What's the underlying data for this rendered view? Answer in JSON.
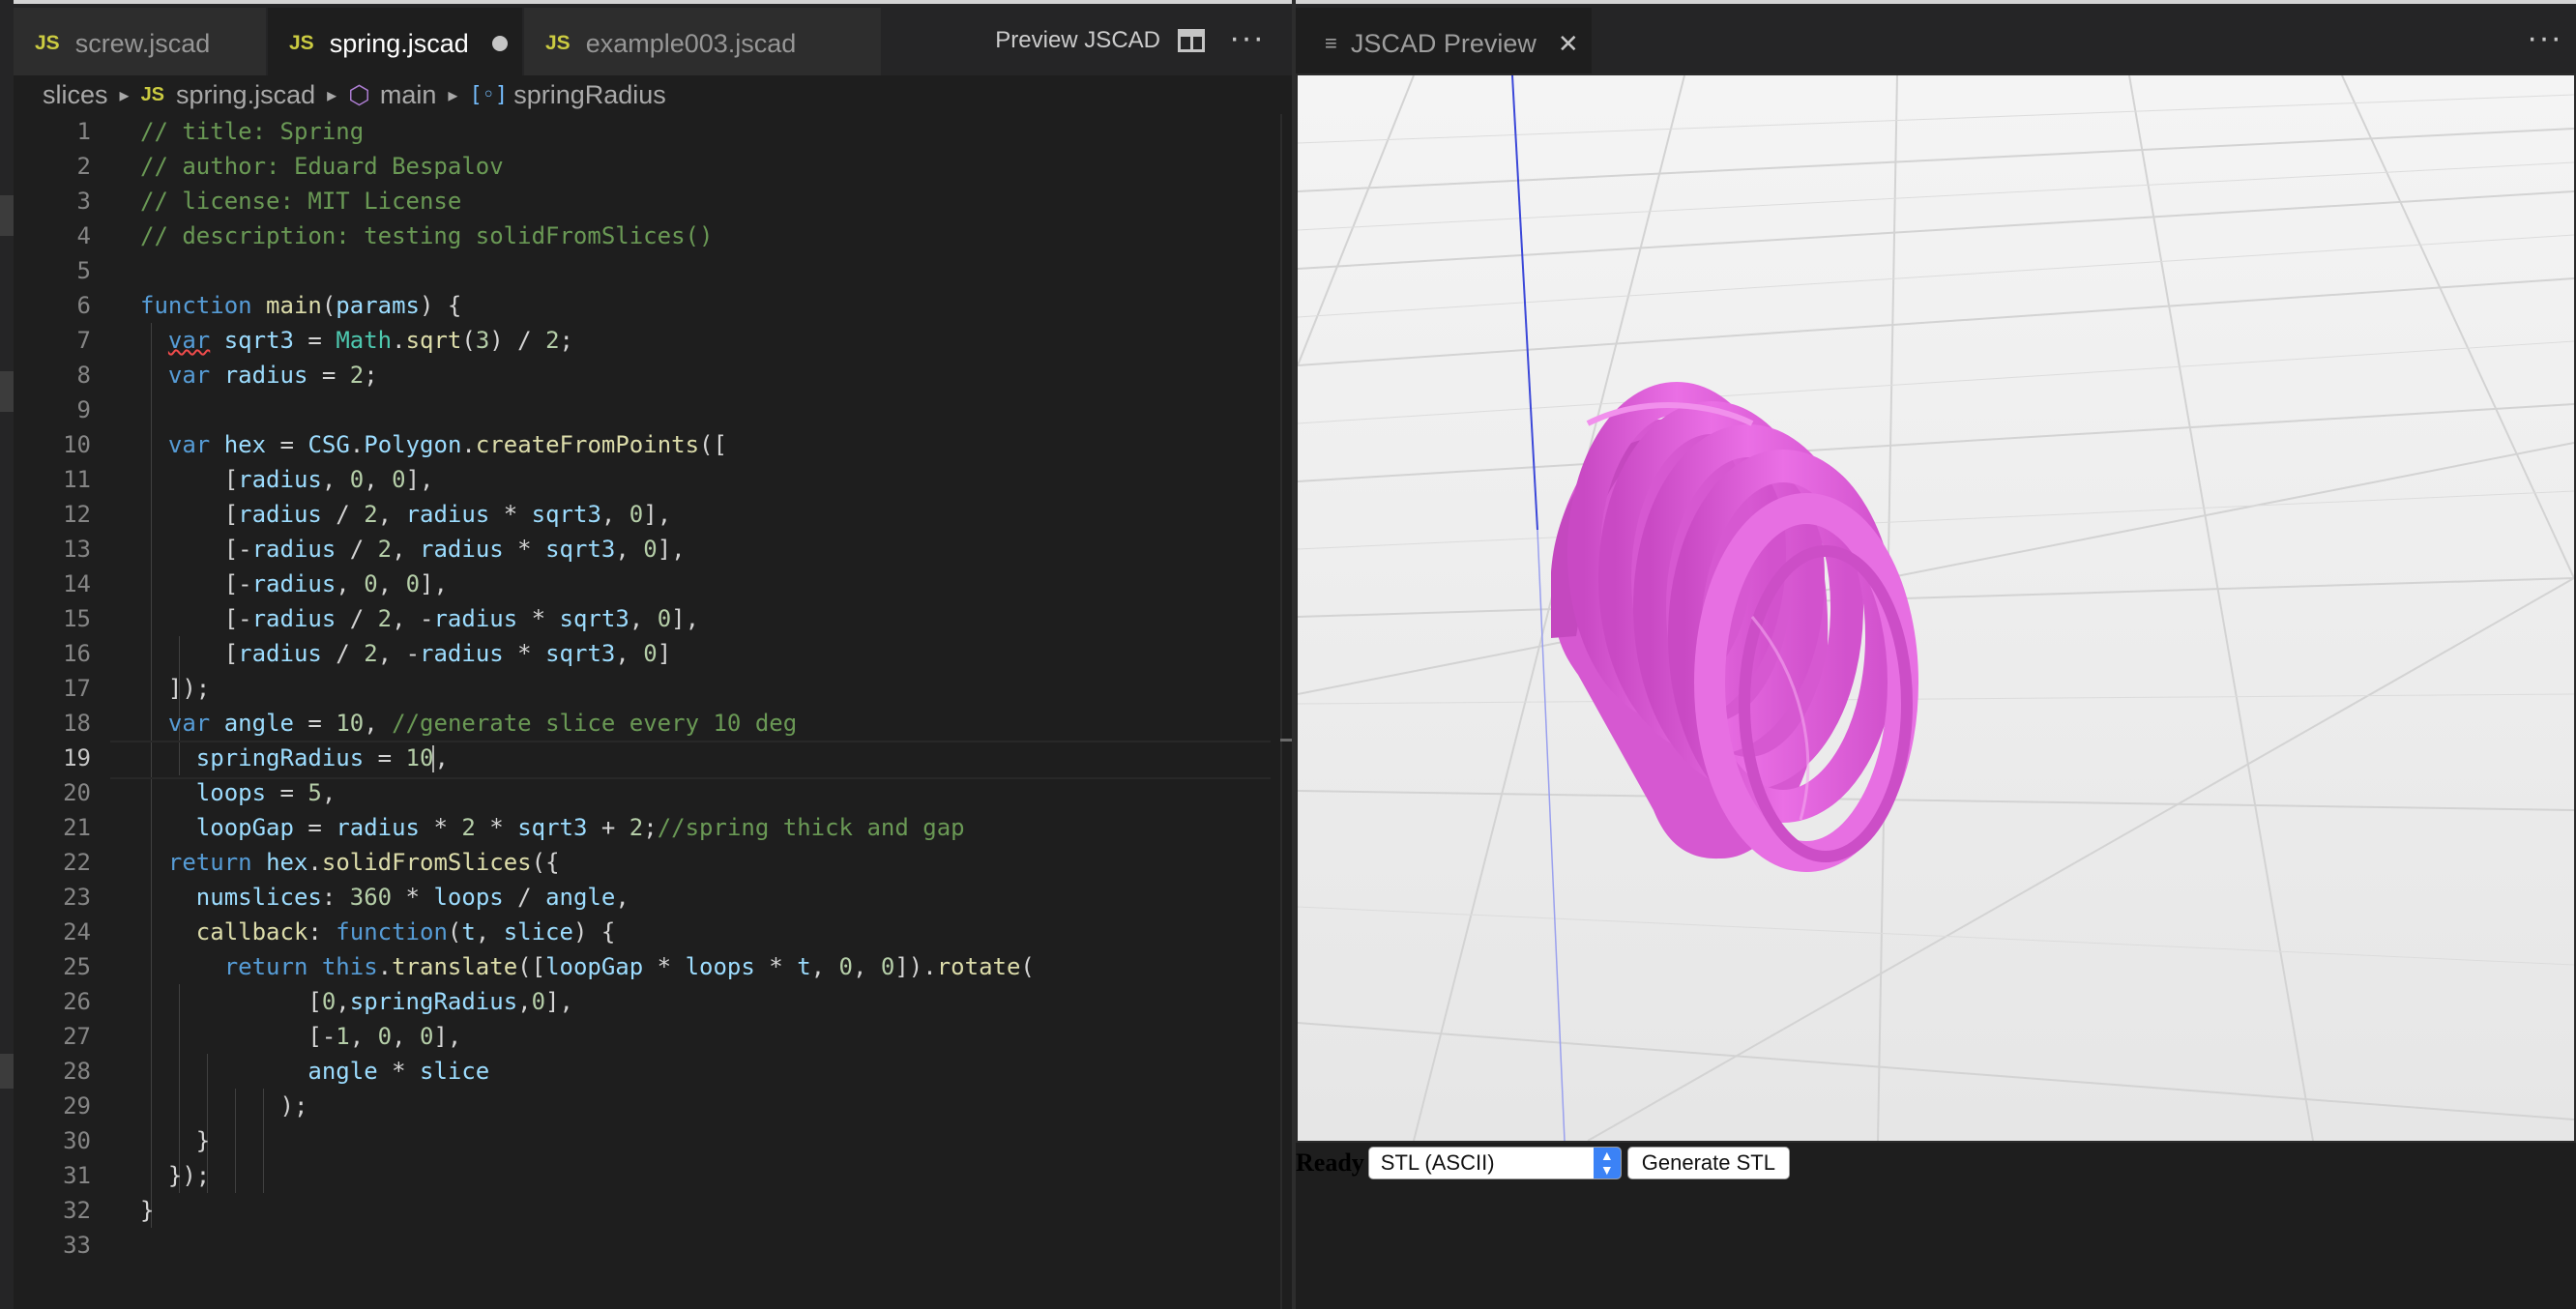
{
  "editor": {
    "tabs": [
      {
        "icon": "JS",
        "label": "screw.jscad"
      },
      {
        "icon": "JS",
        "label": "spring.jscad"
      },
      {
        "icon": "JS",
        "label": "example003.jscad"
      }
    ],
    "preview_action": "Preview JSCAD",
    "more": "···",
    "breadcrumb": {
      "folder": "slices",
      "file_icon": "JS",
      "file": "spring.jscad",
      "function": "main",
      "symbol": "springRadius"
    },
    "current_line": 19,
    "lines": [
      {
        "n": "1"
      },
      {
        "n": "2"
      },
      {
        "n": "3"
      },
      {
        "n": "4"
      },
      {
        "n": "5"
      },
      {
        "n": "6"
      },
      {
        "n": "7"
      },
      {
        "n": "8"
      },
      {
        "n": "9"
      },
      {
        "n": "10"
      },
      {
        "n": "11"
      },
      {
        "n": "12"
      },
      {
        "n": "13"
      },
      {
        "n": "14"
      },
      {
        "n": "15"
      },
      {
        "n": "16"
      },
      {
        "n": "17"
      },
      {
        "n": "18"
      },
      {
        "n": "19"
      },
      {
        "n": "20"
      },
      {
        "n": "21"
      },
      {
        "n": "22"
      },
      {
        "n": "23"
      },
      {
        "n": "24"
      },
      {
        "n": "25"
      },
      {
        "n": "26"
      },
      {
        "n": "27"
      },
      {
        "n": "28"
      },
      {
        "n": "29"
      },
      {
        "n": "30"
      },
      {
        "n": "31"
      },
      {
        "n": "32"
      },
      {
        "n": "33"
      }
    ],
    "code": [
      [
        [
          "c",
          "// title: Spring"
        ]
      ],
      [
        [
          "c",
          "// author: Eduard Bespalov"
        ]
      ],
      [
        [
          "c",
          "// license: MIT License"
        ]
      ],
      [
        [
          "c",
          "// description: testing solidFromSlices()"
        ]
      ],
      [],
      [
        [
          "k",
          "function"
        ],
        [
          "p",
          " "
        ],
        [
          "f",
          "main"
        ],
        [
          "p",
          "("
        ],
        [
          "v",
          "params"
        ],
        [
          "p",
          ") {"
        ]
      ],
      [
        [
          "p",
          "  "
        ],
        [
          "ks",
          "var"
        ],
        [
          "p",
          " "
        ],
        [
          "v",
          "sqrt3"
        ],
        [
          "p",
          " = "
        ],
        [
          "t",
          "Math"
        ],
        [
          "p",
          "."
        ],
        [
          "f",
          "sqrt"
        ],
        [
          "p",
          "("
        ],
        [
          "n",
          "3"
        ],
        [
          "p",
          ") / "
        ],
        [
          "n",
          "2"
        ],
        [
          "p",
          ";"
        ]
      ],
      [
        [
          "p",
          "  "
        ],
        [
          "k",
          "var"
        ],
        [
          "p",
          " "
        ],
        [
          "v",
          "radius"
        ],
        [
          "p",
          " = "
        ],
        [
          "n",
          "2"
        ],
        [
          "p",
          ";"
        ]
      ],
      [],
      [
        [
          "p",
          "  "
        ],
        [
          "k",
          "var"
        ],
        [
          "p",
          " "
        ],
        [
          "v",
          "hex"
        ],
        [
          "p",
          " = "
        ],
        [
          "v",
          "CSG"
        ],
        [
          "p",
          "."
        ],
        [
          "v",
          "Polygon"
        ],
        [
          "p",
          "."
        ],
        [
          "f",
          "createFromPoints"
        ],
        [
          "p",
          "(["
        ]
      ],
      [
        [
          "p",
          "      ["
        ],
        [
          "v",
          "radius"
        ],
        [
          "p",
          ", "
        ],
        [
          "n",
          "0"
        ],
        [
          "p",
          ", "
        ],
        [
          "n",
          "0"
        ],
        [
          "p",
          "],"
        ]
      ],
      [
        [
          "p",
          "      ["
        ],
        [
          "v",
          "radius"
        ],
        [
          "p",
          " / "
        ],
        [
          "n",
          "2"
        ],
        [
          "p",
          ", "
        ],
        [
          "v",
          "radius"
        ],
        [
          "p",
          " * "
        ],
        [
          "v",
          "sqrt3"
        ],
        [
          "p",
          ", "
        ],
        [
          "n",
          "0"
        ],
        [
          "p",
          "],"
        ]
      ],
      [
        [
          "p",
          "      [-"
        ],
        [
          "v",
          "radius"
        ],
        [
          "p",
          " / "
        ],
        [
          "n",
          "2"
        ],
        [
          "p",
          ", "
        ],
        [
          "v",
          "radius"
        ],
        [
          "p",
          " * "
        ],
        [
          "v",
          "sqrt3"
        ],
        [
          "p",
          ", "
        ],
        [
          "n",
          "0"
        ],
        [
          "p",
          "],"
        ]
      ],
      [
        [
          "p",
          "      [-"
        ],
        [
          "v",
          "radius"
        ],
        [
          "p",
          ", "
        ],
        [
          "n",
          "0"
        ],
        [
          "p",
          ", "
        ],
        [
          "n",
          "0"
        ],
        [
          "p",
          "],"
        ]
      ],
      [
        [
          "p",
          "      [-"
        ],
        [
          "v",
          "radius"
        ],
        [
          "p",
          " / "
        ],
        [
          "n",
          "2"
        ],
        [
          "p",
          ", -"
        ],
        [
          "v",
          "radius"
        ],
        [
          "p",
          " * "
        ],
        [
          "v",
          "sqrt3"
        ],
        [
          "p",
          ", "
        ],
        [
          "n",
          "0"
        ],
        [
          "p",
          "],"
        ]
      ],
      [
        [
          "p",
          "      ["
        ],
        [
          "v",
          "radius"
        ],
        [
          "p",
          " / "
        ],
        [
          "n",
          "2"
        ],
        [
          "p",
          ", -"
        ],
        [
          "v",
          "radius"
        ],
        [
          "p",
          " * "
        ],
        [
          "v",
          "sqrt3"
        ],
        [
          "p",
          ", "
        ],
        [
          "n",
          "0"
        ],
        [
          "p",
          "]"
        ]
      ],
      [
        [
          "p",
          "  ]);"
        ]
      ],
      [
        [
          "p",
          "  "
        ],
        [
          "k",
          "var"
        ],
        [
          "p",
          " "
        ],
        [
          "v",
          "angle"
        ],
        [
          "p",
          " = "
        ],
        [
          "n",
          "10"
        ],
        [
          "p",
          ", "
        ],
        [
          "c",
          "//generate slice every 10 deg"
        ]
      ],
      [
        [
          "p",
          "    "
        ],
        [
          "v",
          "springRadius"
        ],
        [
          "p",
          " = "
        ],
        [
          "n",
          "10"
        ],
        [
          "cursor",
          ""
        ],
        [
          "p",
          ","
        ]
      ],
      [
        [
          "p",
          "    "
        ],
        [
          "v",
          "loops"
        ],
        [
          "p",
          " = "
        ],
        [
          "n",
          "5"
        ],
        [
          "p",
          ","
        ]
      ],
      [
        [
          "p",
          "    "
        ],
        [
          "v",
          "loopGap"
        ],
        [
          "p",
          " = "
        ],
        [
          "v",
          "radius"
        ],
        [
          "p",
          " * "
        ],
        [
          "n",
          "2"
        ],
        [
          "p",
          " * "
        ],
        [
          "v",
          "sqrt3"
        ],
        [
          "p",
          " + "
        ],
        [
          "n",
          "2"
        ],
        [
          "p",
          ";"
        ],
        [
          "c",
          "//spring thick and gap"
        ]
      ],
      [
        [
          "p",
          "  "
        ],
        [
          "k",
          "return"
        ],
        [
          "p",
          " "
        ],
        [
          "v",
          "hex"
        ],
        [
          "p",
          "."
        ],
        [
          "f",
          "solidFromSlices"
        ],
        [
          "p",
          "({"
        ]
      ],
      [
        [
          "p",
          "    "
        ],
        [
          "v",
          "numslices"
        ],
        [
          "p",
          ": "
        ],
        [
          "n",
          "360"
        ],
        [
          "p",
          " * "
        ],
        [
          "v",
          "loops"
        ],
        [
          "p",
          " / "
        ],
        [
          "v",
          "angle"
        ],
        [
          "p",
          ","
        ]
      ],
      [
        [
          "p",
          "    "
        ],
        [
          "f",
          "callback"
        ],
        [
          "p",
          ": "
        ],
        [
          "k",
          "function"
        ],
        [
          "p",
          "("
        ],
        [
          "v",
          "t"
        ],
        [
          "p",
          ", "
        ],
        [
          "v",
          "slice"
        ],
        [
          "p",
          ") {"
        ]
      ],
      [
        [
          "p",
          "      "
        ],
        [
          "k",
          "return"
        ],
        [
          "p",
          " "
        ],
        [
          "k",
          "this"
        ],
        [
          "p",
          "."
        ],
        [
          "f",
          "translate"
        ],
        [
          "p",
          "(["
        ],
        [
          "v",
          "loopGap"
        ],
        [
          "p",
          " * "
        ],
        [
          "v",
          "loops"
        ],
        [
          "p",
          " * "
        ],
        [
          "v",
          "t"
        ],
        [
          "p",
          ", "
        ],
        [
          "n",
          "0"
        ],
        [
          "p",
          ", "
        ],
        [
          "n",
          "0"
        ],
        [
          "p",
          "])."
        ],
        [
          "f",
          "rotate"
        ],
        [
          "p",
          "("
        ]
      ],
      [
        [
          "p",
          "            ["
        ],
        [
          "n",
          "0"
        ],
        [
          "p",
          ","
        ],
        [
          "v",
          "springRadius"
        ],
        [
          "p",
          ","
        ],
        [
          "n",
          "0"
        ],
        [
          "p",
          "],"
        ]
      ],
      [
        [
          "p",
          "            [-"
        ],
        [
          "n",
          "1"
        ],
        [
          "p",
          ", "
        ],
        [
          "n",
          "0"
        ],
        [
          "p",
          ", "
        ],
        [
          "n",
          "0"
        ],
        [
          "p",
          "],"
        ]
      ],
      [
        [
          "p",
          "            "
        ],
        [
          "v",
          "angle"
        ],
        [
          "p",
          " * "
        ],
        [
          "v",
          "slice"
        ]
      ],
      [
        [
          "p",
          "          );"
        ]
      ],
      [
        [
          "p",
          "    }"
        ]
      ],
      [
        [
          "p",
          "  });"
        ]
      ],
      [
        [
          "p",
          "}"
        ]
      ],
      []
    ]
  },
  "preview": {
    "tab_icon": "≡",
    "tab_label": "JSCAD Preview",
    "close": "✕",
    "more": "···",
    "status": "Ready",
    "format_select": "STL (ASCII)",
    "generate_button": "Generate STL",
    "model_color": "#e566e0",
    "axis_color": "#3b47d8"
  }
}
